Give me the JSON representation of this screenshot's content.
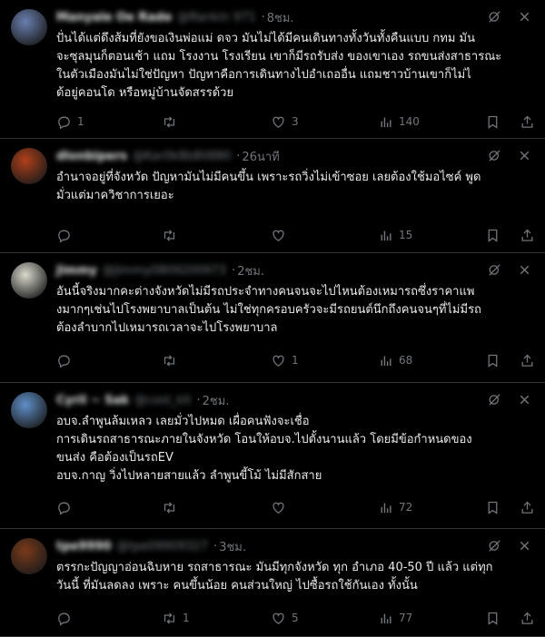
{
  "tweets": [
    {
      "name": "Manyale Oe Rade",
      "handle": "@Rankin 971",
      "time": "8ชม.",
      "avatar_color": "#6a7fb0",
      "lines": [
        "ปั่นได้แต่ดึงส้มที่ยังขอเงินพ่อแม่ ดจว มันไม่ได้มีคนเดินทางทั้งวันทั้งคืนแบบ กทม  มัน",
        "จะซุลมุนก็ตอนเช้า แถม โรงงาน โรงเรียน เขาก็มีรถรับส่ง ของเขาเอง รถขนส่งสาธารณะ",
        "ในตัวเมืองมันไม่ใช่ปัญหา ปัญหาคือการเดินทางไปอำเถออื่น แถมชาวบ้านเขาก็ไม่ไ",
        "ด้อยู่คอนโด หรือหมู่บ้านจัดสรรด้วย"
      ],
      "replies": "1",
      "retweets": "",
      "likes": "3",
      "views": "140"
    },
    {
      "name": "dlonbipers",
      "handle": "@Kar0k8b80880",
      "time": "26นาที",
      "avatar_color": "#b0401a",
      "lines": [
        "อำนาจอยู่ที่จังหวัด ปัญหามันไม่มีคนขึ้น เพราะรถวิ่งไม่เข้าซอย เลยต้องใช้มอไซค์ พูด",
        "มั่วแต่มาควิชาการเยอะ"
      ],
      "replies": "",
      "retweets": "",
      "likes": "",
      "views": "15"
    },
    {
      "name": "Jimmy",
      "handle": "@Jimmy0809200973",
      "time": "2ชม.",
      "avatar_color": "#d8d8cc",
      "lines": [
        "อันนี้จริงมากคะต่างจังหวัดไม่มีรถประจำทางคนจนจะไปไหนต้องเหมารถซึ่งราคาแพ",
        "งมากๆเช่นไปโรงพยาบาลเป็นต้น ไม่ใช่ทุกครอบครัวจะมีรถยนต์นึกถึงคนจนๆที่ไม่มีรถ",
        "ต้องลำบากไปเหมารถเวลาจะไปโรงพยาบาล"
      ],
      "replies": "",
      "retweets": "",
      "likes": "1",
      "views": "68"
    },
    {
      "name": "Cyril ~ Sak",
      "handle": "@cool_kit",
      "time": "2ชม.",
      "avatar_color": "#5f8fc8",
      "lines": [
        "อบจ.ลำพูนล้มเหลว เลยมั่วไปหมด  เผื่อคนฟังจะเชื่อ",
        "การเดินรถสาธารณะภายในจังหวัด โอนให้อบจ.ไปตั้งนานแล้ว โดยมีข้อกำหนดของ",
        "ขนส่ง คือต้องเป็นรถEV",
        "อบจ.กาญ วิ่งไปหลายสายแล้ว  ลำพูนขี้โม้ ไม่มีสักสาย"
      ],
      "replies": "",
      "retweets": "",
      "likes": "",
      "views": "72"
    },
    {
      "name": "tpe9990",
      "handle": "@tpe09909327",
      "time": "3ชม.",
      "avatar_color": "#7a3a1a",
      "lines": [
        "ตรรกะปัญญาอ่อนฉิบหาย รถสาธารณะ มันมีทุกจังหวัด ทุก อำเภอ 40-50 ปี แล้ว แต่ทุก",
        "วันนี้ ที่มันลดลง เพราะ คนขึ้นน้อย คนส่วนใหญ่ ไปซื้อรถใช้กันเอง ทั้งนั้น"
      ],
      "replies": "",
      "retweets": "1",
      "likes": "5",
      "views": "77"
    }
  ],
  "icons": [
    "grok-icon",
    "more-icon",
    "reply-icon",
    "retweet-icon",
    "like-icon",
    "views-icon",
    "bookmark-icon",
    "share-icon"
  ],
  "colors": {
    "background": "#000000",
    "text": "#e7e9ea",
    "muted": "#71767b",
    "divider": "#2f3336"
  }
}
